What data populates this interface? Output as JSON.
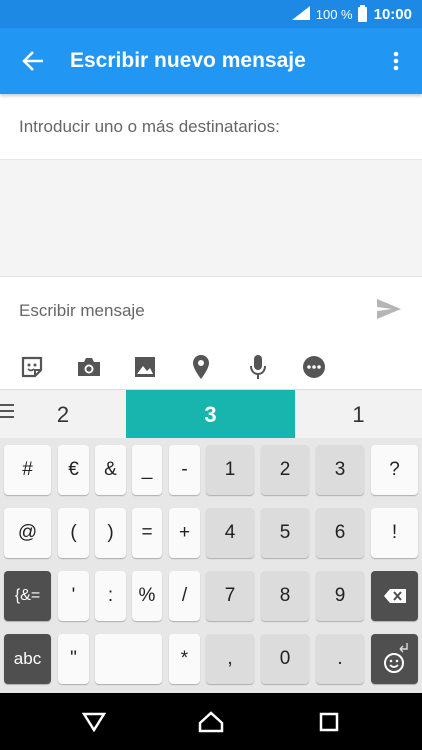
{
  "status_bar": {
    "battery": "100 %",
    "time": "10:00"
  },
  "app_bar": {
    "title": "Escribir nuevo mensaje"
  },
  "recipients": {
    "placeholder": "Introducir uno o más destinatarios:"
  },
  "compose": {
    "placeholder": "Escribir mensaje"
  },
  "attachments": [
    "sticker-icon",
    "camera-icon",
    "image-icon",
    "location-icon",
    "microphone-icon",
    "more-icon"
  ],
  "suggestions": {
    "left": "2",
    "middle": "3",
    "right": "1"
  },
  "keyboard": {
    "row1": [
      "#",
      "€",
      "&",
      "_",
      "-",
      "1",
      "2",
      "3",
      "?"
    ],
    "row2": [
      "@",
      "(",
      ")",
      "=",
      "+",
      "4",
      "5",
      "6",
      "!"
    ],
    "row3": [
      "{&=",
      "'",
      ":",
      "%",
      "/",
      "7",
      "8",
      "9"
    ],
    "row4": [
      "abc",
      "\"",
      "*",
      ",",
      "0",
      "."
    ]
  },
  "colors": {
    "status_bar": "#1e88e5",
    "app_bar": "#2196f3",
    "suggestion_highlight": "#17b5ad"
  }
}
